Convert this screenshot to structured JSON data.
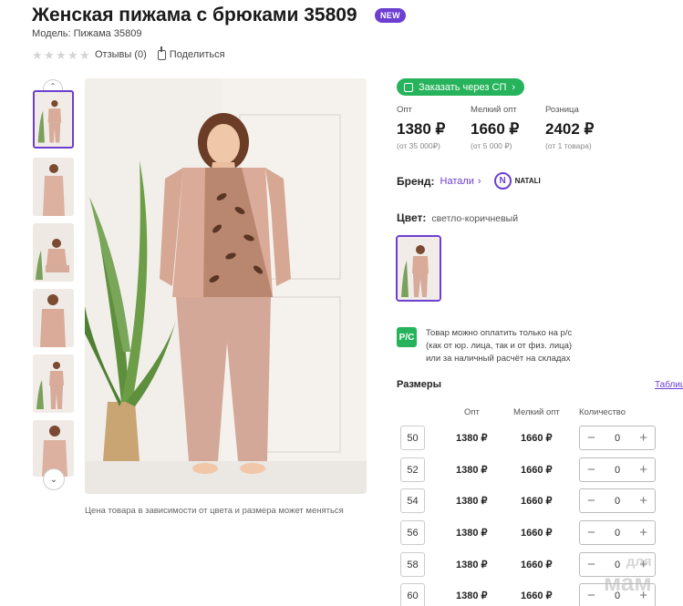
{
  "product": {
    "title": "Женская пижама с брюками 35809",
    "badge": "NEW",
    "model": "Модель: Пижама 35809"
  },
  "rating": {
    "stars": 0,
    "reviews_label": "Отзывы (0)",
    "share_label": "Поделиться"
  },
  "gallery": {
    "note": "Цена товара в зависимости от цвета и размера может меняться"
  },
  "order_button": "Заказать через СП",
  "prices": [
    {
      "label": "Опт",
      "value": "1380 ₽",
      "sub": "(от 35 000₽)"
    },
    {
      "label": "Мелкий опт",
      "value": "1660 ₽",
      "sub": "(от 5 000 ₽)"
    },
    {
      "label": "Розница",
      "value": "2402 ₽",
      "sub": "(от 1 товара)"
    }
  ],
  "brand": {
    "label": "Бренд:",
    "name": "Натали",
    "logo_text": "NATALI"
  },
  "color": {
    "label": "Цвет:",
    "value": "светло-коричневый"
  },
  "payment": {
    "icon_text": "P/C",
    "line1": "Товар можно оплатить только на р/с",
    "line2": "(как от юр. лица, так и от физ. лица)",
    "line3": "или за наличный расчёт на складах"
  },
  "sizes": {
    "title": "Размеры",
    "table_link": "Таблиц",
    "headers": {
      "opt": "Опт",
      "small_opt": "Мелкий опт",
      "qty": "Количество"
    },
    "rows": [
      {
        "size": "50",
        "opt": "1380 ₽",
        "small_opt": "1660 ₽",
        "qty": "0"
      },
      {
        "size": "52",
        "opt": "1380 ₽",
        "small_opt": "1660 ₽",
        "qty": "0"
      },
      {
        "size": "54",
        "opt": "1380 ₽",
        "small_opt": "1660 ₽",
        "qty": "0"
      },
      {
        "size": "56",
        "opt": "1380 ₽",
        "small_opt": "1660 ₽",
        "qty": "0"
      },
      {
        "size": "58",
        "opt": "1380 ₽",
        "small_opt": "1660 ₽",
        "qty": "0"
      },
      {
        "size": "60",
        "opt": "1380 ₽",
        "small_opt": "1660 ₽",
        "qty": "0"
      }
    ]
  },
  "watermark": {
    "line1": "для",
    "line2": "мам"
  },
  "colors": {
    "accent": "#6c3fd1",
    "green": "#26b35b",
    "pajama": "#d9ab98"
  }
}
